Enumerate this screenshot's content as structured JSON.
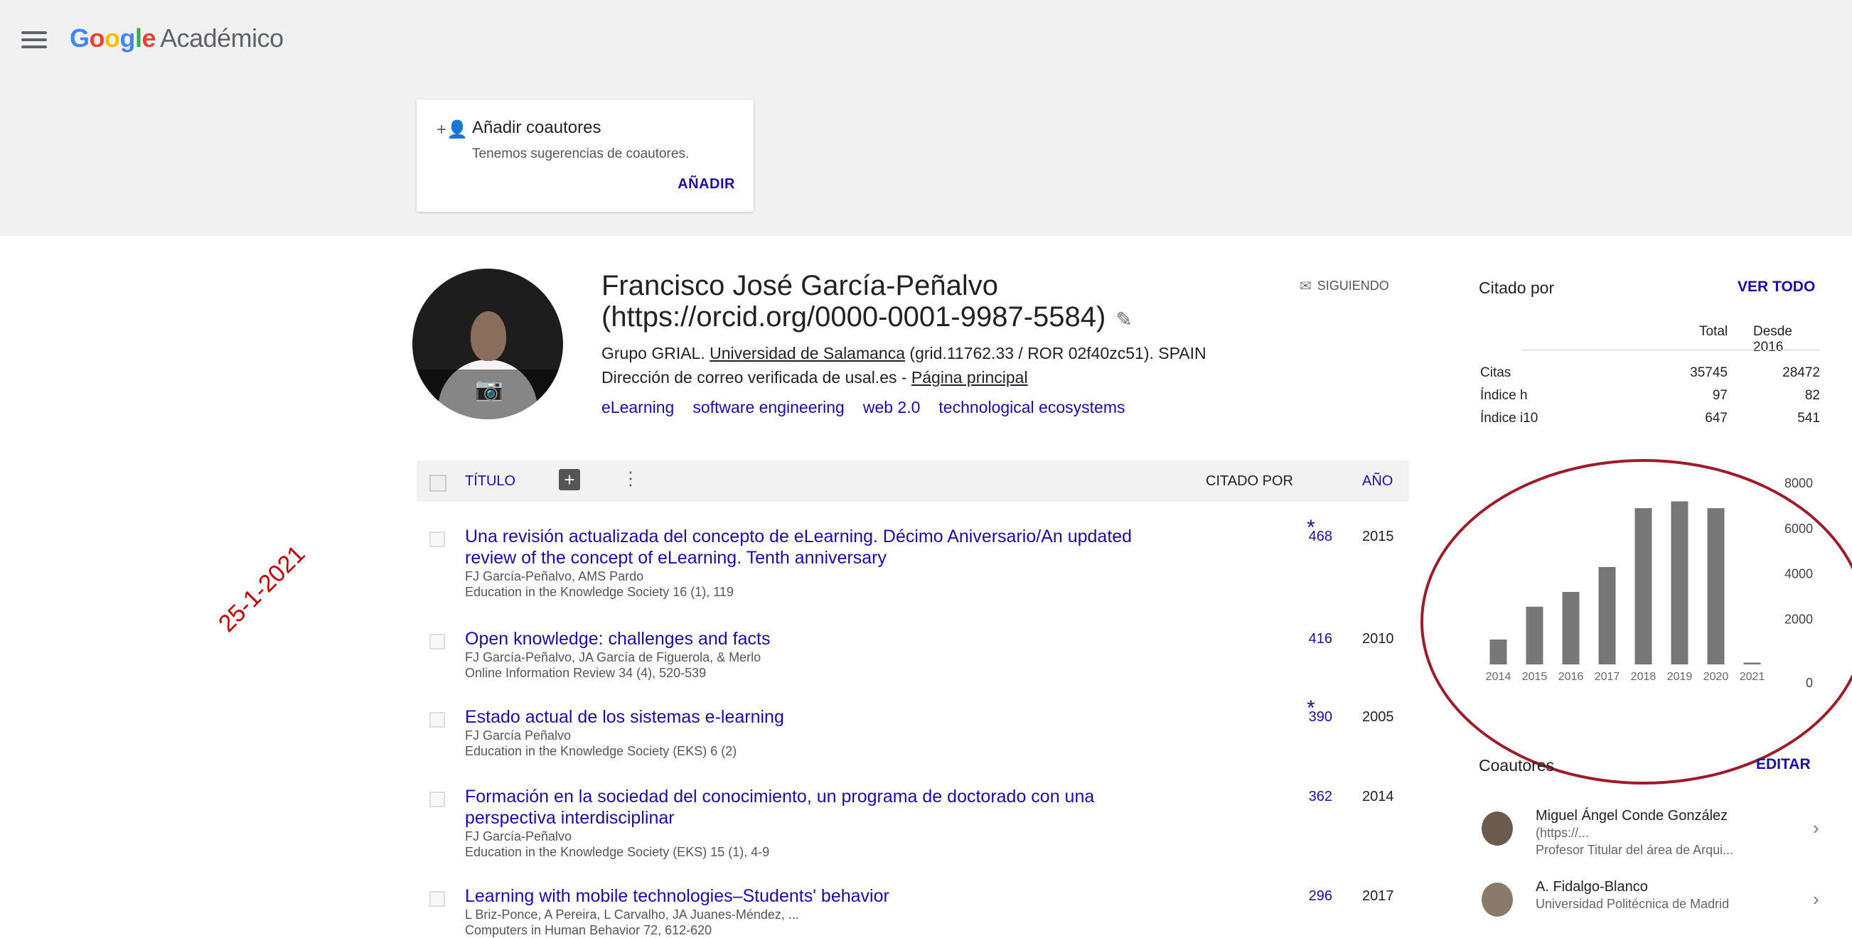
{
  "header": {
    "brand": "Google",
    "product": "Académico"
  },
  "suggest_card": {
    "title": "Añadir coautores",
    "subtitle": "Tenemos sugerencias de coautores.",
    "button": "AÑADIR"
  },
  "annotation_date": "25-1-2021",
  "profile": {
    "name_line1": "Francisco José García-Peñalvo",
    "name_line2": "(https://orcid.org/0000-0001-9987-5584)",
    "follow_button": "SIGUIENDO",
    "affiliation_prefix": "Grupo GRIAL. ",
    "affiliation_link": "Universidad de Salamanca",
    "affiliation_suffix": " (grid.11762.33 / ROR 02f40zc51). SPAIN",
    "email_text": "Dirección de correo verificada de usal.es - ",
    "homepage_link": "Página principal",
    "interests": [
      "eLearning",
      "software engineering",
      "web 2.0",
      "technological ecosystems"
    ]
  },
  "table": {
    "col_title": "TÍTULO",
    "col_cited": "CITADO POR",
    "col_year": "AÑO",
    "rows": [
      {
        "title": "Una revisión actualizada del concepto de eLearning. Décimo Aniversario/An updated review of the concept of eLearning. Tenth anniversary",
        "authors": "FJ García-Peñalvo, AMS Pardo",
        "venue": "Education in the Knowledge Society 16 (1), 119",
        "cited": "468",
        "star": "*",
        "year": "2015"
      },
      {
        "title": "Open knowledge: challenges and facts",
        "authors": "FJ García-Peñalvo, JA García de Figuerola, & Merlo",
        "venue": "Online Information Review 34 (4), 520-539",
        "cited": "416",
        "star": "",
        "year": "2010"
      },
      {
        "title": "Estado actual de los sistemas e-learning",
        "authors": "FJ García Peñalvo",
        "venue": "Education in the Knowledge Society (EKS) 6 (2)",
        "cited": "390",
        "star": "*",
        "year": "2005"
      },
      {
        "title": "Formación en la sociedad del conocimiento, un programa de doctorado con una perspectiva interdisciplinar",
        "authors": "FJ García-Peñalvo",
        "venue": "Education in the Knowledge Society (EKS) 15 (1), 4-9",
        "cited": "362",
        "star": "",
        "year": "2014"
      },
      {
        "title": "Learning with mobile technologies–Students' behavior",
        "authors": "L Briz-Ponce, A Pereira, L Carvalho, JA Juanes-Méndez, ...",
        "venue": "Computers in Human Behavior 72, 612-620",
        "cited": "296",
        "star": "",
        "year": "2017"
      }
    ]
  },
  "cited_by": {
    "title": "Citado por",
    "view_all": "VER TODO",
    "col_total": "Total",
    "col_since": "Desde 2016",
    "rows": [
      {
        "label": "Citas",
        "total": "35745",
        "since": "28472"
      },
      {
        "label": "Índice h",
        "total": "97",
        "since": "82"
      },
      {
        "label": "Índice i10",
        "total": "647",
        "since": "541"
      }
    ]
  },
  "chart_data": {
    "type": "bar",
    "categories": [
      "2014",
      "2015",
      "2016",
      "2017",
      "2018",
      "2019",
      "2020",
      "2021"
    ],
    "values": [
      1100,
      2550,
      3200,
      4300,
      6900,
      7200,
      6900,
      80
    ],
    "ylim": [
      0,
      8000
    ],
    "yticks": [
      "8000",
      "6000",
      "4000",
      "2000",
      "0"
    ],
    "bar_color": "#777777",
    "annotation_color": "#9c1c2a"
  },
  "coauthors": {
    "title": "Coautores",
    "edit": "EDITAR",
    "items": [
      {
        "name": "Miguel Ángel Conde González",
        "line2": "(https://...",
        "affil": "Profesor Titular del área de Arqui..."
      },
      {
        "name": "A. Fidalgo-Blanco",
        "line2": "",
        "affil": "Universidad Politécnica de Madrid"
      }
    ]
  }
}
